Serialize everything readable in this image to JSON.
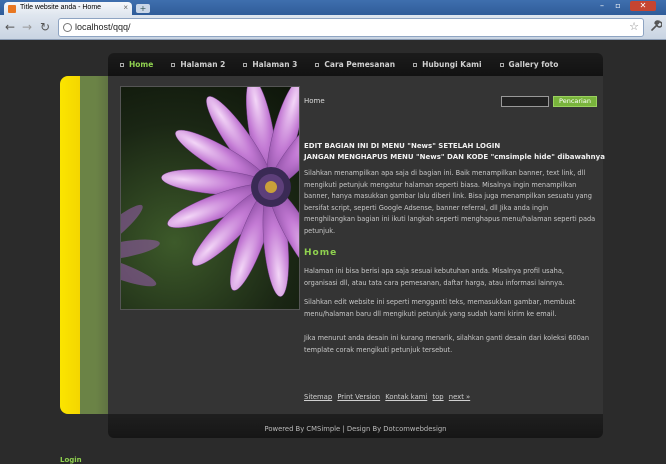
{
  "browser": {
    "tab_title": "Title website anda - Home",
    "new_tab_label": "+",
    "url": "localhost/qqq/",
    "back": "←",
    "forward": "→",
    "reload": "↻",
    "star": "☆",
    "wrench": "🔧",
    "win_min": "–",
    "win_max": "▫",
    "win_close": "✕",
    "tab_close": "×"
  },
  "nav": {
    "items": [
      {
        "label": "Home",
        "active": true
      },
      {
        "label": "Halaman 2",
        "active": false
      },
      {
        "label": "Halaman 3",
        "active": false
      },
      {
        "label": "Cara Pemesanan",
        "active": false
      },
      {
        "label": "Hubungi Kami",
        "active": false
      },
      {
        "label": "Gallery foto",
        "active": false
      }
    ]
  },
  "main": {
    "breadcrumb": "Home",
    "search_button": "Pencarian",
    "headline_1": "EDIT BAGIAN INI DI MENU \"News\" SETELAH LOGIN",
    "headline_2": "JANGAN MENGHAPUS MENU \"News\" DAN KODE \"cmsimple hide\" dibawahnya",
    "paragraph_1": "Silahkan menampilkan apa saja di bagian ini. Baik menampilkan banner, text link, dll mengikuti petunjuk mengatur halaman seperti biasa. Misalnya ingin menampilkan banner, hanya masukkan gambar lalu diberi link. Bisa juga menampilkan sesuatu yang bersifat script, seperti Google Adsense, banner referral, dll Jika anda ingin menghilangkan bagian ini ikuti langkah seperti menghapus menu/halaman seperti pada petunjuk.",
    "section_title": "Home",
    "paragraph_2": "Halaman ini bisa berisi apa saja sesuai kebutuhan anda. Misalnya profil usaha, organisasi dll, atau tata cara pemesanan, daftar harga, atau informasi lainnya.",
    "paragraph_3": "Silahkan edit website ini seperti mengganti teks, memasukkan gambar, membuat menu/halaman baru dll mengikuti petunjuk yang sudah kami kirim ke email.",
    "paragraph_4": "Jika menurut anda desain ini kurang menarik, silahkan ganti desain dari koleksi 600an template corak mengikuti petunjuk tersebut.",
    "footer_links": [
      "Sitemap",
      "Print Version",
      "Kontak kami",
      "top",
      "next »"
    ]
  },
  "footer": {
    "credit": "Powered By CMSimple | Design By Dotcomwebdesign",
    "login": "Login"
  },
  "colors": {
    "accent_green": "#8fd14f",
    "yellow_bar": "#fbe500",
    "olive_bar": "#6b8346",
    "background": "#2b2b2b"
  }
}
